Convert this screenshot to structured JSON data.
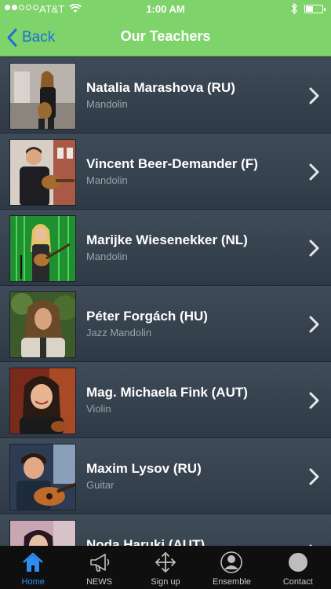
{
  "status": {
    "carrier": "AT&T",
    "time": "1:00 AM"
  },
  "nav": {
    "back_label": "Back",
    "title": "Our Teachers"
  },
  "teachers": [
    {
      "name": "Natalia Marashova (RU)",
      "instrument": "Mandolin"
    },
    {
      "name": "Vincent Beer-Demander (F)",
      "instrument": "Mandolin"
    },
    {
      "name": "Marijke Wiesenekker (NL)",
      "instrument": "Mandolin"
    },
    {
      "name": "Péter Forgách (HU)",
      "instrument": "Jazz Mandolin"
    },
    {
      "name": "Mag. Michaela Fink (AUT)",
      "instrument": "Violin"
    },
    {
      "name": "Maxim Lysov (RU)",
      "instrument": "Guitar"
    },
    {
      "name": "Noda Haruki (AUT)",
      "instrument": ""
    }
  ],
  "tabs": [
    {
      "label": "Home",
      "icon": "home-icon",
      "active": true
    },
    {
      "label": "NEWS",
      "icon": "megaphone-icon",
      "active": false
    },
    {
      "label": "Sign up",
      "icon": "move-arrows-icon",
      "active": false
    },
    {
      "label": "Ensemble",
      "icon": "person-icon",
      "active": false
    },
    {
      "label": "Contact",
      "icon": "circle-icon",
      "active": false
    }
  ],
  "colors": {
    "header": "#7fd36b",
    "back": "#1e6fd6",
    "row": "#3a4652",
    "tab_active": "#2f8df0",
    "tabbar": "#0f0f0f"
  }
}
